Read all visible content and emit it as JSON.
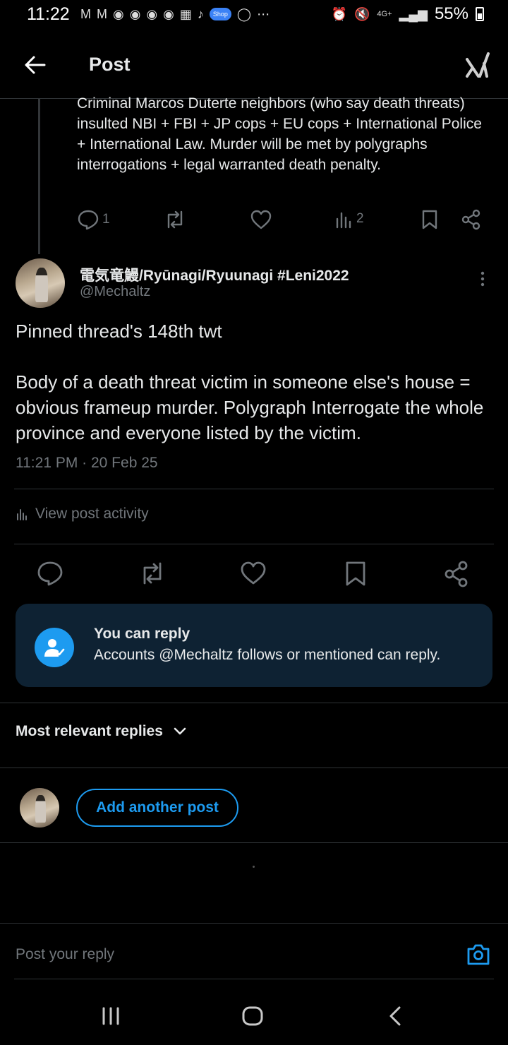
{
  "status_bar": {
    "time": "11:22",
    "battery": "55%",
    "network": "4G+",
    "shop_label": "Shop"
  },
  "header": {
    "title": "Post"
  },
  "previous_post": {
    "text": "Criminal Marcos Duterte neighbors (who say death threats) insulted NBI + FBI + JP cops + EU cops + International Police + International Law. Murder will be met by polygraphs interrogations + legal warranted death penalty.",
    "reply_count": "1",
    "view_count": "2"
  },
  "post": {
    "author_name": "電気竜鰻/Ryūnagi/Ryuunagi #Leni2022",
    "author_handle": "@Mechaltz",
    "body": "Pinned thread's 148th twt\n\nBody of a death threat victim in someone else's house = obvious frameup murder. Polygraph Interrogate the whole province and everyone listed by the victim.",
    "timestamp": "11:21 PM · 20 Feb 25",
    "activity_label": "View post activity"
  },
  "reply_info": {
    "title": "You can reply",
    "subtitle": "Accounts @Mechaltz follows or mentioned can reply."
  },
  "replies": {
    "sort_label": "Most relevant replies",
    "add_post_label": "Add another post"
  },
  "composer": {
    "placeholder": "Post your reply"
  },
  "colors": {
    "accent": "#1d9bf0",
    "muted": "#71767b",
    "card_bg": "#0e2233"
  }
}
